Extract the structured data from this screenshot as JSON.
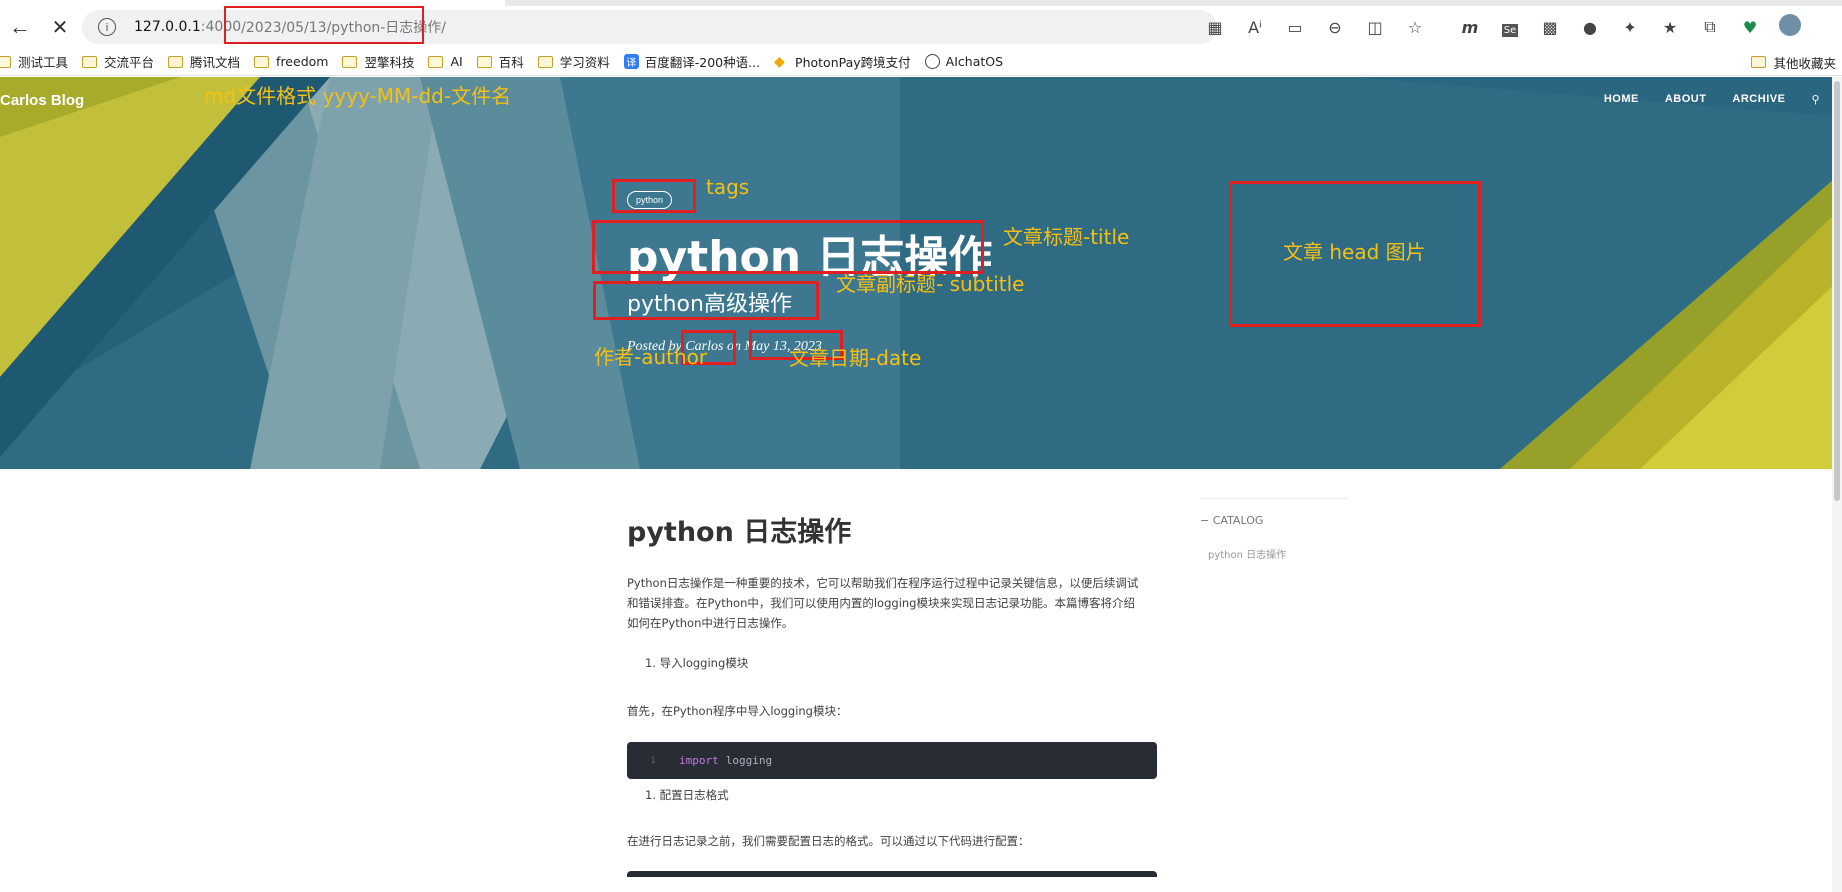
{
  "browser": {
    "address": {
      "host": "127.0.0.1",
      "port": ":4000",
      "path": "/2023/05/13/python-日志操作/"
    },
    "toolbar_icons": [
      "grid-icon",
      "read-aloud-icon",
      "reader-icon",
      "zoom-out-icon",
      "split-screen-icon",
      "favorite-star-icon"
    ],
    "extension_icons": [
      "m-extension-icon",
      "selenium-icon",
      "app-icon",
      "github-icon",
      "extensions-puzzle-icon",
      "favorites-icon",
      "collections-icon",
      "health-icon",
      "profile-avatar"
    ],
    "bookmarks": [
      {
        "label": "测试工具",
        "icon": "folder"
      },
      {
        "label": "交流平台",
        "icon": "folder"
      },
      {
        "label": "腾讯文档",
        "icon": "folder"
      },
      {
        "label": "freedom",
        "icon": "folder"
      },
      {
        "label": "翌擎科技",
        "icon": "folder"
      },
      {
        "label": "AI",
        "icon": "folder"
      },
      {
        "label": "百科",
        "icon": "folder"
      },
      {
        "label": "学习资料",
        "icon": "folder"
      },
      {
        "label": "百度翻译-200种语...",
        "icon": "translate"
      },
      {
        "label": "PhotonPay跨境支付",
        "icon": "photonpay"
      },
      {
        "label": "AIchatOS",
        "icon": "aichat"
      }
    ],
    "other_bookmarks": "其他收藏夹"
  },
  "site": {
    "brand": "Carlos Blog",
    "nav": [
      "HOME",
      "ABOUT",
      "ARCHIVE"
    ]
  },
  "post": {
    "tag": "python",
    "title": "python 日志操作",
    "subtitle": "python高级操作",
    "posted_by": "Posted by",
    "author": "Carlos",
    "on": "on",
    "date": "May 13, 2023"
  },
  "annotations": {
    "md_format": "md文件格式 yyyy-MM-dd-文件名",
    "tags": "tags",
    "title": "文章标题-title",
    "subtitle": "文章副标题- subtitle",
    "author": "作者-author",
    "date": "文章日期-date",
    "head_image": "文章 head 图片"
  },
  "article": {
    "heading": "python 日志操作",
    "intro_line1": "Python日志操作是一种重要的技术，它可以帮助我们在程序运行过程中记录关键信息，以便后续调试",
    "intro_line2": "和错误排查。在Python中，我们可以使用内置的logging模块来实现日志记录功能。本篇博客将介绍",
    "intro_line3": "如何在Python中进行日志操作。",
    "step1": "1. 导入logging模块",
    "step1_text": "首先，在Python程序中导入logging模块：",
    "code_line_no": "1",
    "code_keyword": "import",
    "code_rest": "logging",
    "step2": "1. 配置日志格式",
    "step2_text": "在进行日志记录之前，我们需要配置日志的格式。可以通过以下代码进行配置："
  },
  "catalog": {
    "title": "CATALOG",
    "items": [
      "python 日志操作"
    ]
  },
  "colors": {
    "annotation": "#f6c013",
    "highlight_box": "#e02020",
    "hero_teal": "#2f6c84",
    "hero_yellow": "#b8b62a",
    "code_bg": "#282c34"
  }
}
